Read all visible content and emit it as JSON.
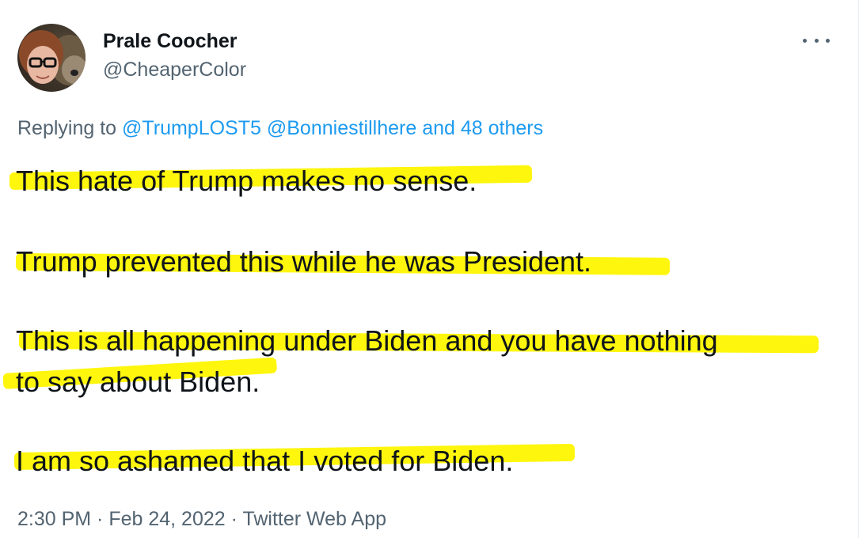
{
  "author": {
    "name": "Prale Coocher",
    "handle": "@CheaperColor"
  },
  "icons": {
    "more": "more-horizontal-icon",
    "avatar": "profile-photo"
  },
  "replying": {
    "prefix": "Replying to ",
    "mention1": "@TrumpLOST5",
    "mention2": "@Bonniestillhere",
    "others": "and 48 others"
  },
  "tweet": {
    "line1": "This hate of Trump makes no sense.",
    "line2": "Trump prevented this while he was President.",
    "line3a": "This is all happening under Biden and you have nothing",
    "line3b": "to say about Biden.",
    "line4": "I am so ashamed that I voted for Biden."
  },
  "meta": {
    "time": "2:30 PM",
    "sep1": " · ",
    "date": "Feb 24, 2022",
    "sep2": " · ",
    "source": "Twitter Web App"
  },
  "colors": {
    "highlight": "#fff500",
    "link": "#1d9bf0",
    "secondary": "#536471",
    "text": "#0f1419"
  }
}
